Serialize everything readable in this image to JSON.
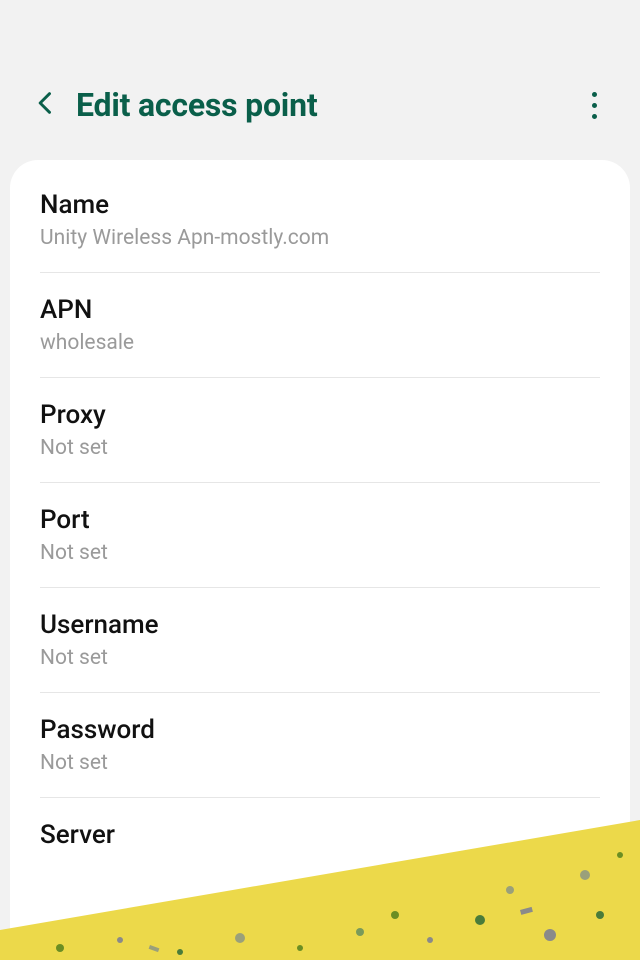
{
  "header": {
    "title": "Edit access point"
  },
  "rows": [
    {
      "label": "Name",
      "value": "Unity Wireless Apn-mostly.com"
    },
    {
      "label": "APN",
      "value": "wholesale"
    },
    {
      "label": "Proxy",
      "value": "Not set"
    },
    {
      "label": "Port",
      "value": "Not set"
    },
    {
      "label": "Username",
      "value": "Not set"
    },
    {
      "label": "Password",
      "value": "Not set"
    },
    {
      "label": "Server",
      "value": ""
    }
  ]
}
